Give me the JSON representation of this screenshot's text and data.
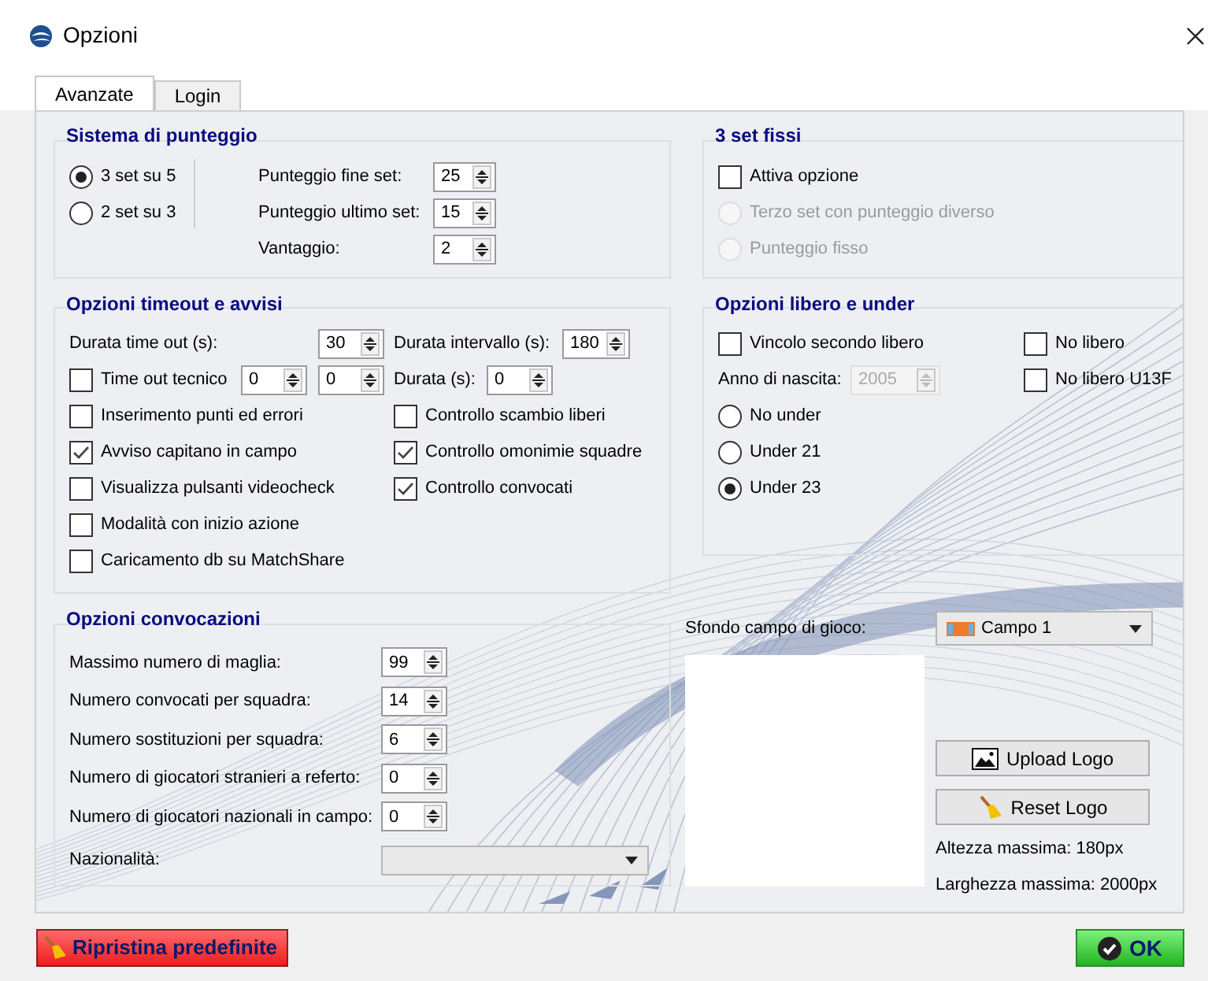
{
  "window": {
    "title": "Opzioni"
  },
  "tabs": [
    {
      "label": "Avanzate",
      "selected": true
    },
    {
      "label": "Login",
      "selected": false
    }
  ],
  "scoring": {
    "title": "Sistema di punteggio",
    "modes": [
      {
        "label": "3 set su 5",
        "selected": true
      },
      {
        "label": "2 set su 3",
        "selected": false
      }
    ],
    "fields": [
      {
        "label": "Punteggio fine set:",
        "value": "25"
      },
      {
        "label": "Punteggio ultimo set:",
        "value": "15"
      },
      {
        "label": "Vantaggio:",
        "value": "2"
      }
    ]
  },
  "fixed_sets": {
    "title": "3 set fissi",
    "option": {
      "label": "Attiva opzione",
      "checked": false
    },
    "choices": [
      {
        "label": "Terzo set con punteggio diverso",
        "selected": false,
        "disabled": true
      },
      {
        "label": "Punteggio fisso",
        "selected": false,
        "disabled": true
      }
    ]
  },
  "timeout": {
    "title": "Opzioni timeout e avvisi",
    "timeout_duration": {
      "label": "Durata time out (s):",
      "value": "30"
    },
    "interval": {
      "label": "Durata intervallo (s):",
      "value": "180"
    },
    "technical": {
      "label": "Time out tecnico",
      "checked": false,
      "values": [
        "0",
        "0"
      ],
      "duration_label": "Durata (s):",
      "duration_value": "0"
    },
    "checks_left": [
      {
        "label": "Inserimento punti ed errori",
        "checked": false
      },
      {
        "label": "Avviso capitano in campo",
        "checked": true
      },
      {
        "label": "Visualizza pulsanti videocheck",
        "checked": false
      },
      {
        "label": "Modalità con inizio azione",
        "checked": false
      },
      {
        "label": "Caricamento db su MatchShare",
        "checked": false
      }
    ],
    "checks_right": [
      {
        "label": "Controllo scambio liberi",
        "checked": false
      },
      {
        "label": "Controllo omonimie squadre",
        "checked": true
      },
      {
        "label": "Controllo convocati",
        "checked": true
      }
    ]
  },
  "libero": {
    "title": "Opzioni libero e under",
    "second_libero": {
      "label": "Vincolo secondo libero",
      "checked": false
    },
    "no_libero": [
      {
        "label": "No libero",
        "checked": false
      },
      {
        "label": "No libero U13F",
        "checked": false
      }
    ],
    "birth_year": {
      "label": "Anno di nascita:",
      "value": "2005",
      "disabled": true
    },
    "under": [
      {
        "label": "No under",
        "selected": false
      },
      {
        "label": "Under 21",
        "selected": false
      },
      {
        "label": "Under 23",
        "selected": true
      }
    ]
  },
  "convocations": {
    "title": "Opzioni convocazioni",
    "fields": [
      {
        "label": "Massimo numero di maglia:",
        "value": "99"
      },
      {
        "label": "Numero convocati per squadra:",
        "value": "14"
      },
      {
        "label": "Numero sostituzioni per squadra:",
        "value": "6"
      },
      {
        "label": "Numero di giocatori stranieri a referto:",
        "value": "0"
      },
      {
        "label": "Numero di giocatori nazionali in campo:",
        "value": "0"
      }
    ],
    "nationality": {
      "label": "Nazionalità:"
    }
  },
  "field_background": {
    "label": "Sfondo campo di gioco:",
    "value": "Campo 1"
  },
  "logo": {
    "upload": "Upload Logo",
    "reset": "Reset Logo",
    "max_height": "Altezza massima: 180px",
    "max_width": "Larghezza massima: 2000px"
  },
  "footer": {
    "restore": "Ripristina predefinite",
    "ok": "OK"
  }
}
